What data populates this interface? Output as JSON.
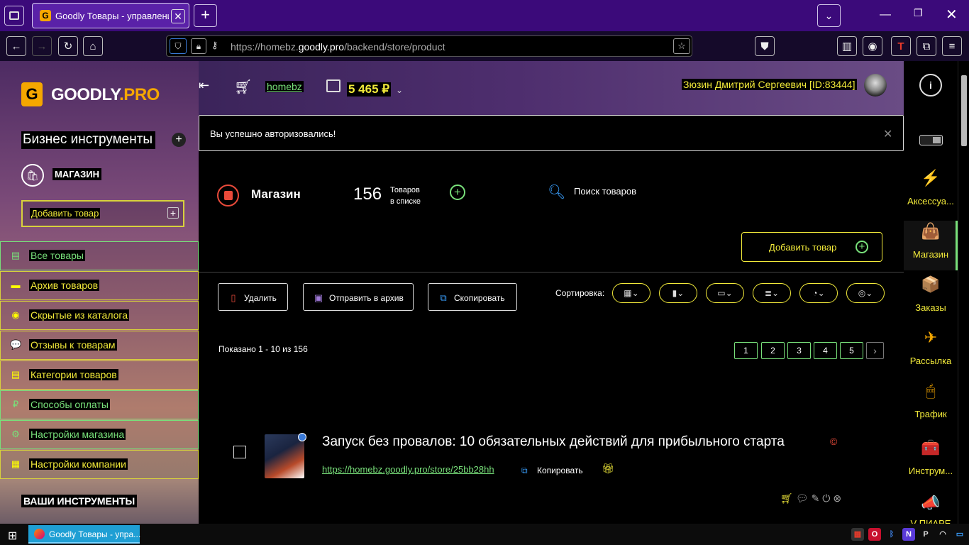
{
  "browser": {
    "tab_title": "Goodly Товары - управление",
    "tab_favicon": "G",
    "url_prefix": "https://homebz.",
    "url_domain": "goodly.pro",
    "url_path": "/backend/store/product",
    "new_tab": "+",
    "window_controls": {
      "minimize": "—",
      "maximize": "❐",
      "close": "✕"
    }
  },
  "sidebar": {
    "logo_mark": "G",
    "logo_goodly": "GOODLY",
    "logo_pro": ".PRO",
    "business_tools": "Бизнес инструменты",
    "plus": "+",
    "shop_label": "МАГАЗИН",
    "add_product": "Добавить товар",
    "add_plus": "+",
    "items": [
      {
        "label": "Все товары",
        "icon": "list-icon",
        "glyph": "▤"
      },
      {
        "label": "Архив товаров",
        "icon": "archive-icon",
        "glyph": "▬"
      },
      {
        "label": "Скрытые из каталога",
        "icon": "eye-off-icon",
        "glyph": "◉"
      },
      {
        "label": "Отзывы к товарам",
        "icon": "comments-icon",
        "glyph": "💬"
      },
      {
        "label": "Категории товаров",
        "icon": "categories-icon",
        "glyph": "▤"
      },
      {
        "label": "Способы оплаты",
        "icon": "ruble-icon",
        "glyph": "₽"
      },
      {
        "label": "Настройки магазина",
        "icon": "gear-icon",
        "glyph": "⚙"
      },
      {
        "label": "Настройки компании",
        "icon": "building-icon",
        "glyph": "▦"
      }
    ],
    "your_tools": "ВАШИ ИНСТРУМЕНТЫ"
  },
  "header": {
    "shop_link": "homebz",
    "balance": "5 465 ₽",
    "user_name": "Зюзин Дмитрий Сергеевич [ID:83444]"
  },
  "alert": {
    "message": "Вы успешно авторизовались!",
    "close": "✕"
  },
  "store": {
    "title": "Магазин",
    "count": "156",
    "count_line1": "Товаров",
    "count_line2": "в списке",
    "add_circle": "+",
    "search_label": "Поиск товаров",
    "add_button": "Добавить товар",
    "add_button_plus": "+"
  },
  "actions": {
    "delete": "Удалить",
    "archive": "Отправить в архив",
    "copy": "Скопировать",
    "sort_label": "Сортировка:"
  },
  "sort_buttons": [
    {
      "icon": "calendar-sort-icon",
      "glyph": "▦⌄"
    },
    {
      "icon": "doc-sort-icon",
      "glyph": "▮⌄"
    },
    {
      "icon": "wallet-sort-icon",
      "glyph": "▭⌄"
    },
    {
      "icon": "stack-sort-icon",
      "glyph": "≣⌄"
    },
    {
      "icon": "lock-sort-icon",
      "glyph": "◔⌄"
    },
    {
      "icon": "hidden-sort-icon",
      "glyph": "◎⌄"
    }
  ],
  "pagination": {
    "shown": "Показано 1 - 10 из 156",
    "pages": [
      "1",
      "2",
      "3",
      "4",
      "5"
    ],
    "next": "›"
  },
  "product": {
    "title": "Запуск без провалов: 10 обязательных действий для прибыльного старта",
    "copyright": "©",
    "url": "https://homebz.goodly.pro/store/25bb28hh",
    "copy": "Копировать"
  },
  "rail": {
    "info": "i",
    "items": [
      {
        "label": "Аксессуа...",
        "icon": "accessories-icon",
        "glyph": "⚡"
      },
      {
        "label": "Магазин",
        "icon": "shopping-bag-icon",
        "glyph": "👜"
      },
      {
        "label": "Заказы",
        "icon": "orders-icon",
        "glyph": "📦"
      },
      {
        "label": "Рассылка",
        "icon": "paper-plane-icon",
        "glyph": "✈"
      },
      {
        "label": "Трафик",
        "icon": "mouse-icon",
        "glyph": "🖱"
      },
      {
        "label": "Инструм...",
        "icon": "toolbox-icon",
        "glyph": "🧰"
      },
      {
        "label": "V ПИАРЕ",
        "icon": "megaphone-icon",
        "glyph": "📣"
      }
    ]
  },
  "taskbar": {
    "app_label": "Goodly Товары - упра...",
    "start": "⊞"
  },
  "colors": {
    "accent_yellow": "#f2ea3a",
    "accent_green": "#78e07a",
    "brand_orange": "#f5a700",
    "titlebar": "#3b0a7a"
  }
}
